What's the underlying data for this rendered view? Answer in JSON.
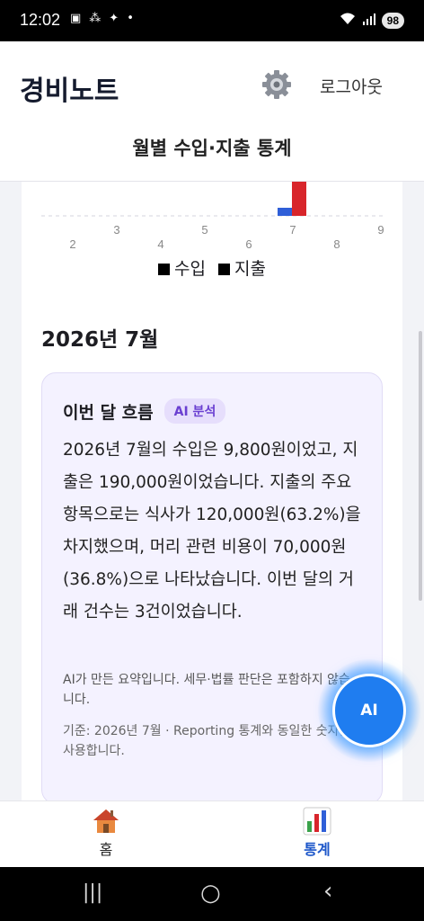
{
  "status_bar": {
    "time": "12:02",
    "battery": "98"
  },
  "header": {
    "app_title": "경비노트",
    "logout_label": "로그아웃",
    "page_subtitle": "월별 수입·지출 통계"
  },
  "chart_data": {
    "type": "bar",
    "categories": [
      "2",
      "3",
      "4",
      "5",
      "6",
      "7",
      "8",
      "9"
    ],
    "series": [
      {
        "name": "수입",
        "values": [
          0,
          0,
          0,
          0,
          0,
          9800,
          0,
          0
        ],
        "color": "#2f5fd8"
      },
      {
        "name": "지출",
        "values": [
          0,
          0,
          0,
          0,
          0,
          190000,
          0,
          0
        ],
        "color": "#d8252b"
      }
    ],
    "grid": true,
    "legend": "bottom-center"
  },
  "month": {
    "title": "2026년 7월"
  },
  "flow": {
    "title": "이번 달 흐름",
    "badge": "AI 분석",
    "body": "2026년 7월의 수입은 9,800원이었고, 지출은 190,000원이었습니다. 지출의 주요 항목으로는 식사가 120,000원(63.2%)을 차지했으며, 머리 관련 비용이 70,000원(36.8%)으로 나타났습니다. 이번 달의 거래 건수는 3건이었습니다.",
    "note": "AI가 만든 요약입니다. 세무·법률 판단은 포함하지 않습니다.",
    "basis": "기준: 2026년 7월 · Reporting 통계와 동일한 숫자를 사용합니다."
  },
  "fab": {
    "label": "AI"
  },
  "bottom_nav": {
    "items": [
      {
        "label": "홈",
        "icon": "home-icon"
      },
      {
        "label": "통계",
        "icon": "bar-chart-icon"
      }
    ]
  }
}
